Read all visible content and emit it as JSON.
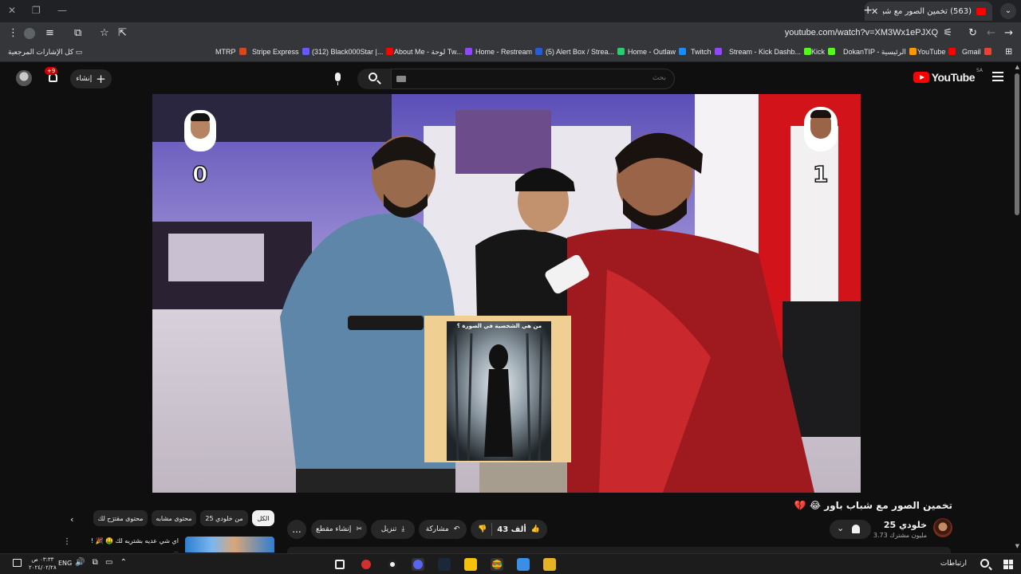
{
  "browser": {
    "tab_title": "(563) تخمين الصور مع شباب",
    "url": "youtube.com/watch?v=XM3Wx1ePJXQ",
    "all_bookmarks": "كل الإشارات المرجعية",
    "bookmarks": [
      {
        "label": "MTRP",
        "color": "#d44a1c"
      },
      {
        "label": "Stripe Express",
        "color": "#635bff"
      },
      {
        "label": "(312) Black000Star |...",
        "color": "#ff0000"
      },
      {
        "label": "About Me - لوحة Tw...",
        "color": "#9146ff"
      },
      {
        "label": "Home - Restream",
        "color": "#2a5bd7"
      },
      {
        "label": "(5) Alert Box / Strea...",
        "color": "#2ecc71"
      },
      {
        "label": "Home - Outlaw",
        "color": "#1a8cff"
      },
      {
        "label": "Twitch",
        "color": "#9146ff"
      },
      {
        "label": "Stream - Kick Dashb...",
        "color": "#53fc18"
      },
      {
        "label": "Kick",
        "color": "#53fc18"
      },
      {
        "label": "DokanTIP - الرئيسية",
        "color": "#ff9800"
      },
      {
        "label": "YouTube",
        "color": "#ff0000"
      },
      {
        "label": "Gmail",
        "color": "#ea4335"
      }
    ]
  },
  "header": {
    "logo_text": "YouTube",
    "country_code": "SA",
    "search_placeholder": "بحث",
    "create_label": "إنشاء",
    "notif_count": "+9"
  },
  "video": {
    "score_left": "0",
    "score_right": "1",
    "card_question": "من هي الشخصية في الصورة ؟",
    "title": "تخمين الصور مع شباب باور 😂 💔",
    "channel": "خلودي 25",
    "subscribers": "3.73 مليون مشترك",
    "likes": "43 ألف",
    "share": "مشاركة",
    "download": "تنزيل",
    "clip": "إنشاء مقطع",
    "more": "..."
  },
  "chips": [
    {
      "label": "الكل",
      "active": true
    },
    {
      "label": "من خلودي 25",
      "active": false
    },
    {
      "label": "محتوى مشابه",
      "active": false
    },
    {
      "label": "محتوى مقترَح لك",
      "active": false
    }
  ],
  "recommendation": {
    "title": "اي شي عديه بشتريه لك 🤑 🎉 !",
    "meta": "...",
    "more": "⋮"
  },
  "taskbar": {
    "search_label": "ارتباطات",
    "lang": "ENG",
    "time": "٠٣:٣٣ ص",
    "date": "٢٠٢٤/٠٢/٢٨"
  }
}
